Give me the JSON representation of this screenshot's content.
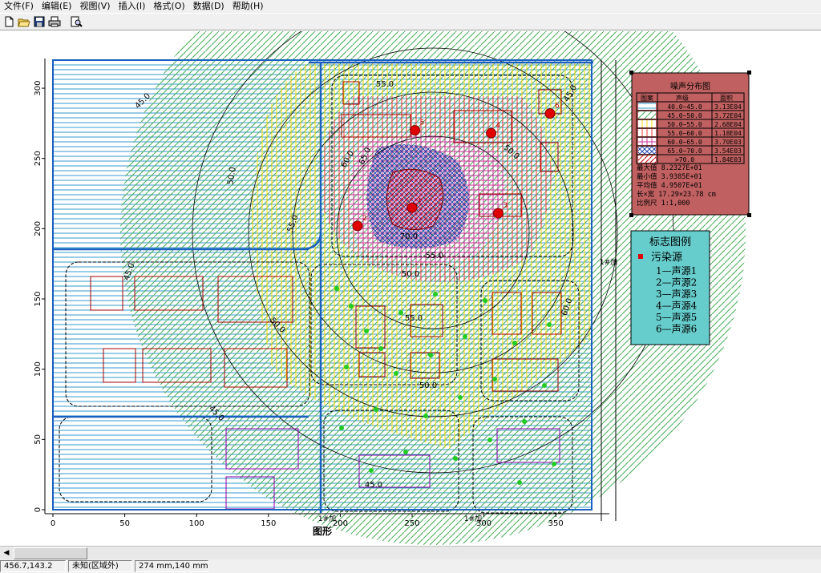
{
  "menu": [
    "文件(F)",
    "编辑(E)",
    "视图(V)",
    "插入(I)",
    "格式(O)",
    "数据(D)",
    "帮助(H)"
  ],
  "toolbar": {
    "icons": [
      "new-icon",
      "open-icon",
      "save-icon",
      "print-icon",
      "preview-icon"
    ]
  },
  "chart_data": {
    "type": "contour-map",
    "xlabel": "图形",
    "xticks": [
      "0",
      "50",
      "100",
      "150",
      "200",
      "250",
      "300",
      "350"
    ],
    "yticks": [
      "0",
      "50",
      "100",
      "150",
      "200",
      "250",
      "300"
    ],
    "xlim": [
      0,
      375
    ],
    "ylim": [
      0,
      320
    ],
    "contour_labels": [
      "45.0",
      "50.0",
      "55.0",
      "60.0",
      "65.0",
      "70.0",
      "55.0",
      "50.0",
      "45.0",
      "50.0",
      "55.0",
      "45.0",
      "45.0",
      "60.0",
      "50.0",
      "55.0",
      "50.0",
      "45.0"
    ],
    "point_sources": [
      {
        "id": "1",
        "x": 250,
        "y": 215
      },
      {
        "id": "2",
        "x": 212,
        "y": 202
      },
      {
        "id": "3",
        "x": 310,
        "y": 211
      },
      {
        "id": "4",
        "x": 305,
        "y": 268
      },
      {
        "id": "5",
        "x": 252,
        "y": 270
      },
      {
        "id": "6",
        "x": 346,
        "y": 282
      }
    ],
    "side_markers": [
      "1#加",
      "1#加",
      "1#加"
    ],
    "fill_colors": {
      "40-45": "#3399cc",
      "45-50": "#44aa55",
      "50-55": "#ffdd00",
      "55-60": "#ff3333",
      "60-65": "#cc3399",
      "65-70": "#2244aa",
      "70+": "#cc0000"
    }
  },
  "legend": {
    "title": "噪声分布图",
    "headers": [
      "图案",
      "声级",
      "面积"
    ],
    "rows": [
      {
        "level": "40.0~45.0",
        "area": "3.13E04",
        "pattern": "hline",
        "color": "#3399cc"
      },
      {
        "level": "45.0~50.0",
        "area": "3.72E04",
        "pattern": "diag",
        "color": "#44aa55"
      },
      {
        "level": "50.0~55.0",
        "area": "2.68E04",
        "pattern": "vline",
        "color": "#ffdd00"
      },
      {
        "level": "55.0~60.0",
        "area": "1.18E04",
        "pattern": "vline",
        "color": "#ff3333"
      },
      {
        "level": "60.0~65.0",
        "area": "3.70E03",
        "pattern": "grid",
        "color": "#cc3399"
      },
      {
        "level": "65.0~70.0",
        "area": "3.54E03",
        "pattern": "cross",
        "color": "#2244aa"
      },
      {
        "level": ">70.0",
        "area": "1.84E03",
        "pattern": "diag",
        "color": "#cc0000"
      }
    ],
    "stats": [
      "最大值  8.2327E+01",
      "最小值  3.9385E+01",
      "平均值  4.9507E+01",
      "长×宽  17.29×23.78 cm",
      "比例尺  1:1,000"
    ]
  },
  "symbol_legend": {
    "title": "标志图例",
    "source_label": "污染源",
    "items": [
      "1—声源1",
      "2—声源2",
      "3—声源3",
      "4—声源4",
      "5—声源5",
      "6—声源6"
    ]
  },
  "status": [
    "456.7,143.2",
    "未知(区域外)",
    "274 mm,140 mm"
  ]
}
